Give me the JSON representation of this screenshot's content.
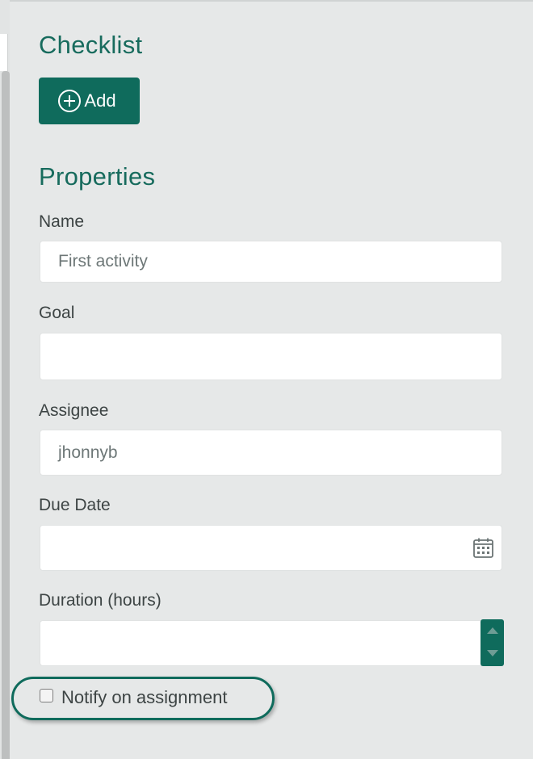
{
  "checklist": {
    "title": "Checklist",
    "add_button_label": "Add",
    "add_icon": "plus-circle-icon"
  },
  "properties": {
    "title": "Properties",
    "name": {
      "label": "Name",
      "value": "First activity"
    },
    "goal": {
      "label": "Goal",
      "value": ""
    },
    "assignee": {
      "label": "Assignee",
      "value": "jhonnyb"
    },
    "due_date": {
      "label": "Due Date",
      "value": "",
      "icon": "calendar-icon"
    },
    "duration": {
      "label": "Duration (hours)",
      "value": "",
      "icon": "spinner-arrows-icon"
    },
    "notify": {
      "label": "Notify on assignment",
      "checked": false
    }
  },
  "colors": {
    "accent": "#0f6b5c",
    "heading": "#176b5d",
    "background": "#e6e8e8",
    "label_text": "#3d4444",
    "input_text": "#6d7777"
  }
}
